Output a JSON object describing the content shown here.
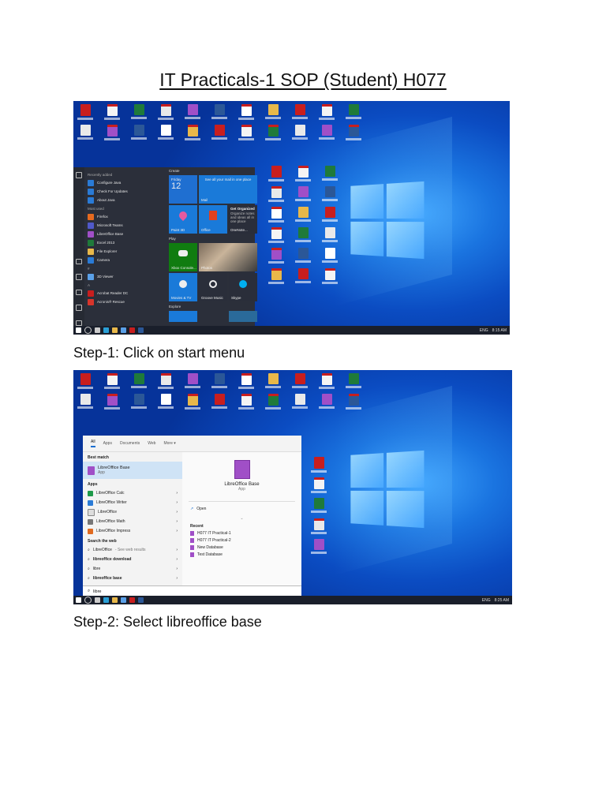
{
  "document": {
    "title": "IT Practicals-1 SOP (Student) H077",
    "step1": "Step-1: Click on start menu",
    "step2": "Step-2: Select libreoffice base"
  },
  "screenshot1": {
    "taskbar_time": "8:15 AM",
    "taskbar_lang": "ENG",
    "start_menu": {
      "recently_added_header": "Recently added",
      "recent_items": [
        "Configure Java",
        "Check For Updates",
        "About Java"
      ],
      "most_used_header": "Most used",
      "most_used": [
        "Firefox",
        "Microsoft Teams",
        "LibreOffice Base",
        "Excel 2013",
        "File Explorer",
        "Camera"
      ],
      "hash_header": "#",
      "hash_items": [
        "3D Viewer"
      ],
      "a_header": "A",
      "a_items": [
        "Acrobat Reader DC",
        "Acronis® Rescue"
      ],
      "create_header": "Create",
      "calendar_day": "Friday",
      "calendar_date": "12",
      "mail_promo": "See all your mail in one place",
      "mail_label": "Mail",
      "tile_paint3d": "Paint 3D",
      "tile_office": "Office",
      "onenote_title": "Get Organized",
      "onenote_desc": "Organize notes and ideas all in one place",
      "tile_onenote": "OneNote...",
      "play_header": "Play",
      "tile_xbox": "Xbox Console...",
      "tile_photos": "Photos",
      "tile_movies": "Movies & TV",
      "tile_groove": "Groove Music",
      "tile_skype": "Skype",
      "explore_header": "Explore"
    }
  },
  "screenshot2": {
    "taskbar_time": "8:25 AM",
    "taskbar_lang": "ENG",
    "search": {
      "tabs": [
        "All",
        "Apps",
        "Documents",
        "Web",
        "More ▾"
      ],
      "best_match_header": "Best match",
      "best_match_name": "LibreOffice Base",
      "best_match_type": "App",
      "apps_header": "Apps",
      "apps": [
        "LibreOffice Calc",
        "LibreOffice Writer",
        "LibreOffice",
        "LibreOffice Math",
        "LibreOffice Impress"
      ],
      "web_header": "Search the web",
      "web_first": "LibreOffice",
      "web_first_suffix": "- See web results",
      "web_items": [
        "libreoffice download",
        "libre",
        "libreoffice base"
      ],
      "preview_name": "LibreOffice Base",
      "preview_type": "App",
      "open_label": "Open",
      "recent_header": "Recent",
      "recent_items": [
        "H077 IT Practical-1",
        "H077 IT Practical-2",
        "New Database",
        "Test Database"
      ],
      "query": "libre"
    }
  }
}
